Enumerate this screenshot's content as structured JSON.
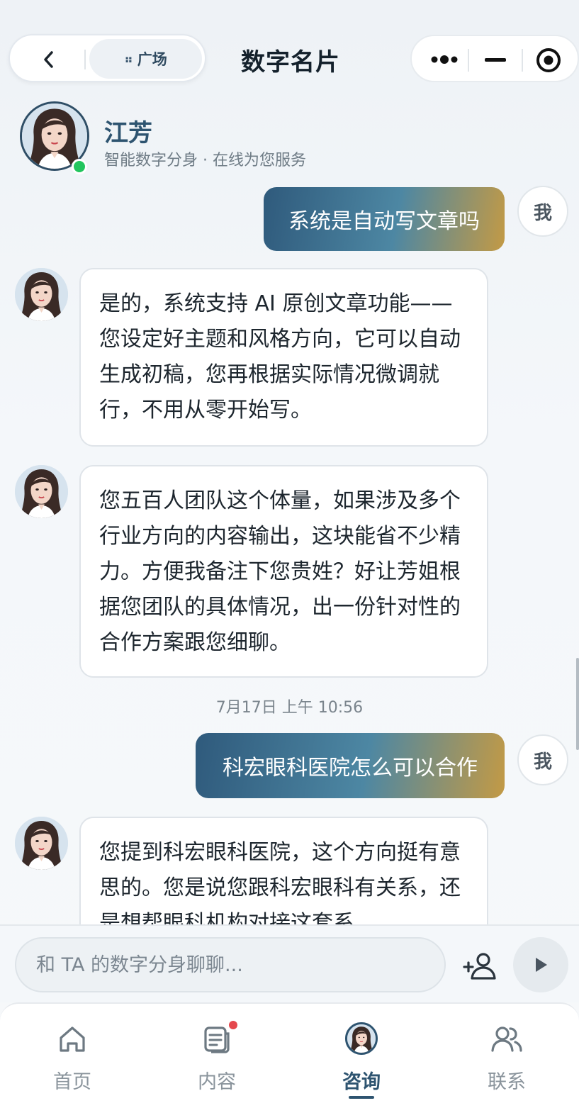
{
  "nav": {
    "back_icon": "chevron-left-icon",
    "square_label": "广场",
    "title": "数字名片",
    "capsule_icons": [
      "more-dots-icon",
      "minimize-icon",
      "target-icon"
    ]
  },
  "profile": {
    "name": "江芳",
    "subtitle": "智能数字分身 · 在线为您服务",
    "status_color": "#22c55e"
  },
  "messages": [
    {
      "role": "user",
      "text": "系统是自动写文章吗",
      "badge": "我"
    },
    {
      "role": "ai",
      "text": "是的，系统支持 AI 原创文章功能——您设定好主题和风格方向，它可以自动生成初稿，您再根据实际情况微调就行，不用从零开始写。"
    },
    {
      "role": "ai",
      "text": "您五百人团队这个体量，如果涉及多个行业方向的内容输出，这块能省不少精力。方便我备注下您贵姓？好让芳姐根据您团队的具体情况，出一份针对性的合作方案跟您细聊。"
    },
    {
      "role": "timestamp",
      "text": "7月17日 上午 10:56"
    },
    {
      "role": "user",
      "text": "科宏眼科医院怎么可以合作",
      "badge": "我"
    },
    {
      "role": "ai",
      "text": "您提到科宏眼科医院，这个方向挺有意思的。您是说您跟科宏眼科有关系，还是想帮眼科机构对接这套系"
    }
  ],
  "input": {
    "placeholder": "和 TA 的数字分身聊聊...",
    "value": "",
    "add_contact_icon": "add-user-icon",
    "send_icon": "send-icon"
  },
  "tabs": [
    {
      "label": "首页",
      "icon": "home-icon",
      "active": false
    },
    {
      "label": "内容",
      "icon": "content-icon",
      "active": false,
      "badge_dot": true
    },
    {
      "label": "咨询",
      "icon": "avatar",
      "active": true
    },
    {
      "label": "联系",
      "icon": "contacts-icon",
      "active": false
    }
  ],
  "colors": {
    "accent": "#2e5470",
    "user_bubble_gradient": [
      "#2f5a7c",
      "#4d87a3",
      "#c39a45"
    ],
    "badge_dot": "#e5484d"
  }
}
